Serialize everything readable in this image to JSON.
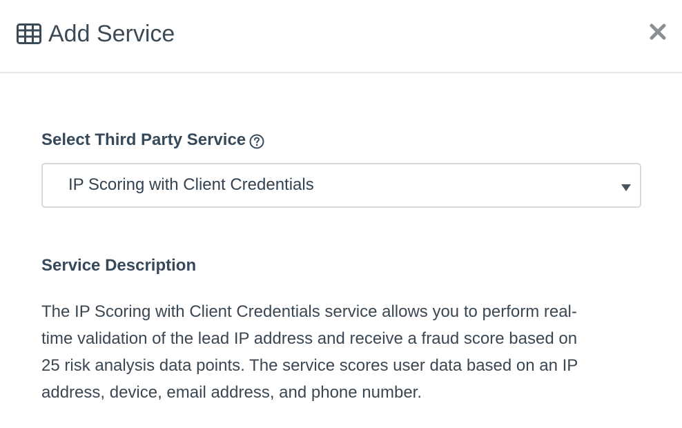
{
  "header": {
    "title": "Add Service",
    "icon": "table-grid-icon",
    "close_icon": "close-icon"
  },
  "form": {
    "service_label": "Select Third Party Service",
    "help_icon": "question-circle-icon",
    "selected_service": "IP Scoring with Client Credentials",
    "dropdown_icon": "caret-down-icon"
  },
  "description": {
    "heading": "Service Description",
    "lines": [
      "The IP Scoring with Client Credentials service allows you to perform real-",
      "time validation of the lead IP address and receive a fraud score based on",
      "25 risk analysis data points. The service scores user data based on an IP",
      "address, device, email address, and phone number."
    ]
  },
  "colors": {
    "text_primary": "#36495a",
    "border": "#d6dadf",
    "divider": "#e5e8eb",
    "close_icon": "#8a9196"
  }
}
